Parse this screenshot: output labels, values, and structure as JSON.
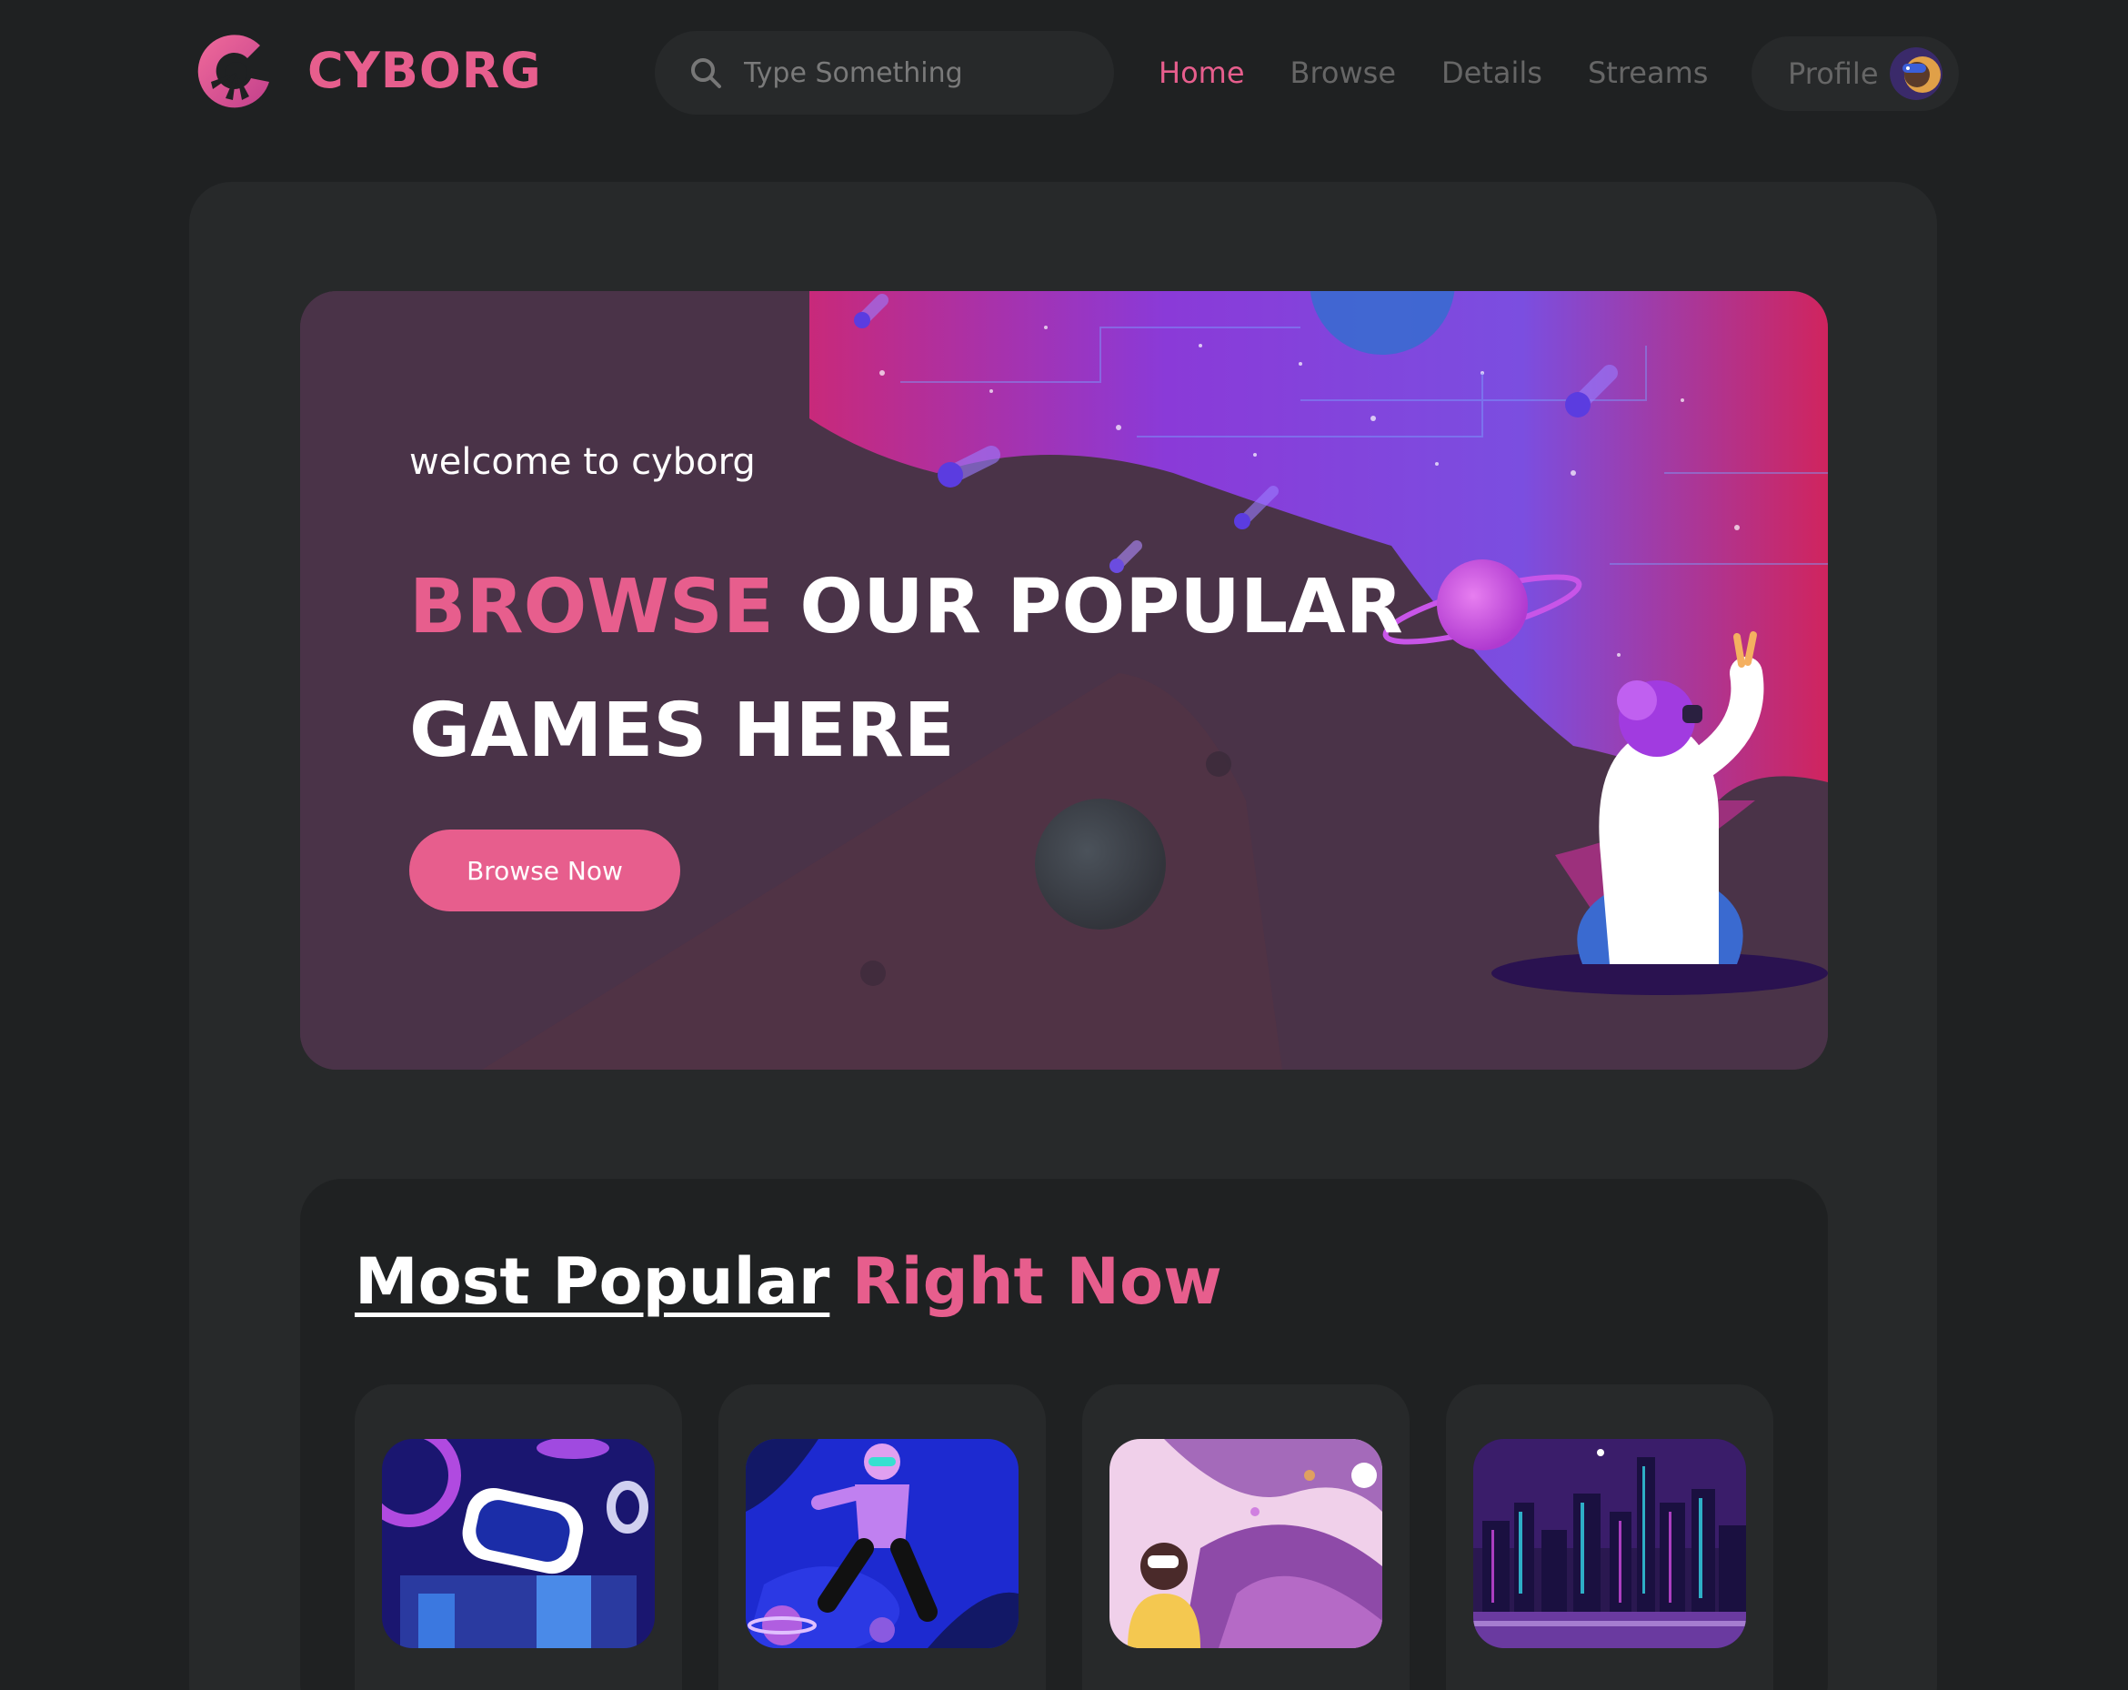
{
  "header": {
    "logo_text": "CYBORG",
    "search": {
      "placeholder": "Type Something"
    },
    "nav": [
      {
        "label": "Home",
        "active": true
      },
      {
        "label": "Browse",
        "active": false
      },
      {
        "label": "Details",
        "active": false
      },
      {
        "label": "Streams",
        "active": false
      }
    ],
    "profile_label": "Profile"
  },
  "banner": {
    "subtitle": "welcome to cyborg",
    "title_accent": "BROWSE",
    "title_rest_line1": " OUR POPULAR",
    "title_line2": "GAMES HERE",
    "button_label": "Browse Now"
  },
  "popular": {
    "title_underlined": "Most Popular",
    "title_accent": "Right Now"
  },
  "colors": {
    "background": "#1f2122",
    "panel": "#27292a",
    "accent": "#e75e8d",
    "nav_inactive": "#666666"
  }
}
